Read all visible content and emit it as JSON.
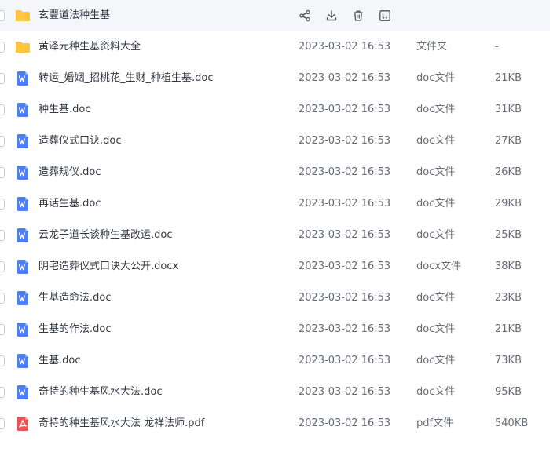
{
  "colors": {
    "folder": "#ffc53d",
    "word": "#4a7ff5",
    "pdf": "#ee5151",
    "hover_row": "#f5f6f9"
  },
  "files": [
    {
      "name": "玄豐道法种生基",
      "date": "",
      "type": "",
      "size": "",
      "icon": "folder-icon",
      "hover": true
    },
    {
      "name": "黄泽元种生基资料大全",
      "date": "2023-03-02 16:53",
      "type": "文件夹",
      "size": "-",
      "icon": "folder-icon"
    },
    {
      "name": "转运_婚姻_招桃花_生财_种植生基.doc",
      "date": "2023-03-02 16:53",
      "type": "doc文件",
      "size": "21KB",
      "icon": "word-file-icon"
    },
    {
      "name": "种生基.doc",
      "date": "2023-03-02 16:53",
      "type": "doc文件",
      "size": "31KB",
      "icon": "word-file-icon"
    },
    {
      "name": "造葬仪式口诀.doc",
      "date": "2023-03-02 16:53",
      "type": "doc文件",
      "size": "27KB",
      "icon": "word-file-icon"
    },
    {
      "name": "造葬规仪.doc",
      "date": "2023-03-02 16:53",
      "type": "doc文件",
      "size": "26KB",
      "icon": "word-file-icon"
    },
    {
      "name": "再话生基.doc",
      "date": "2023-03-02 16:53",
      "type": "doc文件",
      "size": "29KB",
      "icon": "word-file-icon"
    },
    {
      "name": "云龙子道长谈种生基改运.doc",
      "date": "2023-03-02 16:53",
      "type": "doc文件",
      "size": "25KB",
      "icon": "word-file-icon"
    },
    {
      "name": "阴宅造葬仪式口诀大公开.docx",
      "date": "2023-03-02 16:53",
      "type": "docx文件",
      "size": "38KB",
      "icon": "word-file-icon"
    },
    {
      "name": "生基造命法.doc",
      "date": "2023-03-02 16:53",
      "type": "doc文件",
      "size": "23KB",
      "icon": "word-file-icon"
    },
    {
      "name": "生基的作法.doc",
      "date": "2023-03-02 16:53",
      "type": "doc文件",
      "size": "21KB",
      "icon": "word-file-icon"
    },
    {
      "name": "生基.doc",
      "date": "2023-03-02 16:53",
      "type": "doc文件",
      "size": "73KB",
      "icon": "word-file-icon"
    },
    {
      "name": "奇特的种生基风水大法.doc",
      "date": "2023-03-02 16:53",
      "type": "doc文件",
      "size": "95KB",
      "icon": "word-file-icon"
    },
    {
      "name": "奇特的种生基风水大法 龙祥法师.pdf",
      "date": "2023-03-02 16:53",
      "type": "pdf文件",
      "size": "540KB",
      "icon": "pdf-file-icon"
    }
  ],
  "row_actions": [
    "share-icon",
    "download-icon",
    "delete-icon",
    "more-icon"
  ]
}
